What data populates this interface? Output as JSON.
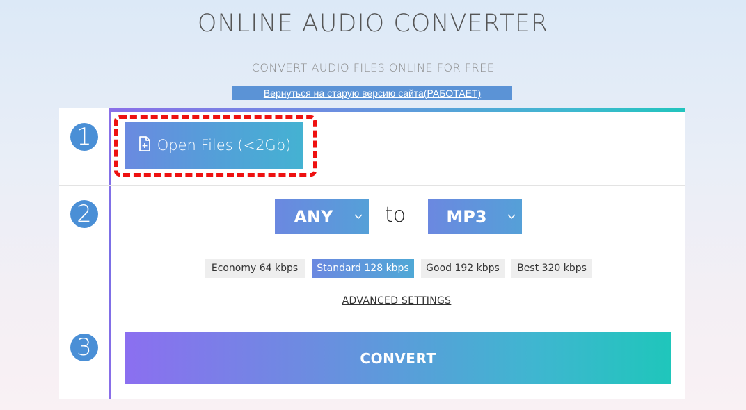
{
  "header": {
    "title": "ONLINE AUDIO CONVERTER",
    "subtitle": "CONVERT AUDIO FILES ONLINE FOR FREE",
    "old_site_link": "Вернуться на старую версию сайта(РАБОТАЕТ)"
  },
  "steps": {
    "step1": {
      "number": "1",
      "open_files_label": "Open Files (<2Gb)"
    },
    "step2": {
      "number": "2",
      "from_format": "ANY",
      "to_label": "to",
      "to_format": "MP3",
      "quality_options": [
        {
          "label": "Economy 64 kbps",
          "selected": false
        },
        {
          "label": "Standard 128 kbps",
          "selected": true
        },
        {
          "label": "Good 192 kbps",
          "selected": false
        },
        {
          "label": "Best 320 kbps",
          "selected": false
        }
      ],
      "advanced_settings_label": "ADVANCED SETTINGS"
    },
    "step3": {
      "number": "3",
      "convert_label": "CONVERT"
    }
  },
  "icons": {
    "open_files": "file-plus-icon",
    "dropdown": "chevron-down-icon"
  },
  "colors": {
    "highlight": "#ee1111",
    "step_number": "#4a8fd6",
    "accent_purple": "#8b6ff0",
    "accent_teal": "#1fc6bb"
  }
}
